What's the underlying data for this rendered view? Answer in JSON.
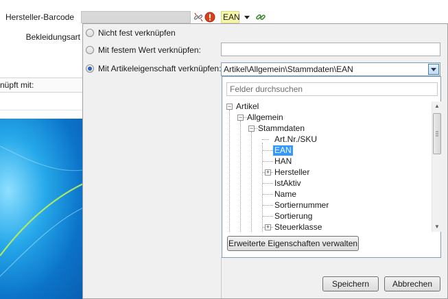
{
  "form": {
    "barcode_label": "Hersteller-Barcode",
    "clothing_label": "Bekleidungsart",
    "linked_label": "nüpft mit:",
    "ean_chip": "EAN"
  },
  "popup": {
    "options": [
      {
        "label": "Nicht fest verknüpfen",
        "checked": false
      },
      {
        "label": "Mit festem Wert verknüpfen:",
        "checked": false
      },
      {
        "label": "Mit Artikeleigenschaft verknüpfen:",
        "checked": true
      }
    ],
    "fixed_value": "",
    "combo_value": "Artikel\\Allgemein\\Stammdaten\\EAN",
    "search_placeholder": "Felder durchsuchen",
    "tree": {
      "root": "Artikel",
      "level1": "Allgemein",
      "level2": "Stammdaten",
      "items": [
        "Art.Nr./SKU",
        "EAN",
        "HAN",
        "Hersteller",
        "IstAktiv",
        "Name",
        "Sortiernummer",
        "Sortierung",
        "Steuerklasse"
      ],
      "selected": "EAN"
    },
    "manage_button": "Erweiterte Eigenschaften verwalten",
    "save_button": "Speichern",
    "cancel_button": "Abbrechen"
  },
  "colors": {
    "selection": "#3399ff",
    "ean_chip_bg": "#f6f6a8",
    "error": "#d9401a"
  }
}
